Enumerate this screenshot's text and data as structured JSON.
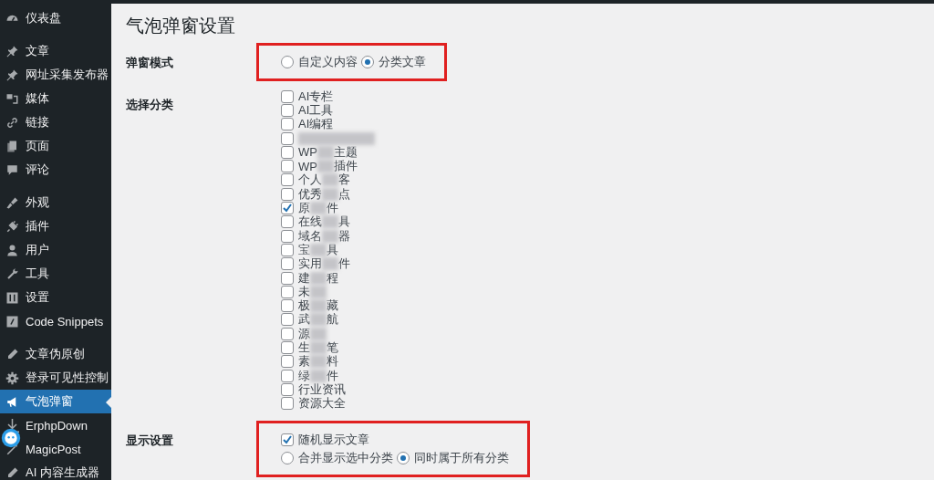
{
  "sidebar": {
    "groups": [
      [
        {
          "label": "仪表盘",
          "selected": false
        }
      ],
      [
        {
          "label": "文章",
          "selected": false
        },
        {
          "label": "网址采集发布器",
          "selected": false
        },
        {
          "label": "媒体",
          "selected": false
        },
        {
          "label": "链接",
          "selected": false
        },
        {
          "label": "页面",
          "selected": false
        },
        {
          "label": "评论",
          "selected": false
        }
      ],
      [
        {
          "label": "外观",
          "selected": false
        },
        {
          "label": "插件",
          "selected": false
        },
        {
          "label": "用户",
          "selected": false
        },
        {
          "label": "工具",
          "selected": false
        },
        {
          "label": "设置",
          "selected": false
        },
        {
          "label": "Code Snippets",
          "selected": false
        }
      ],
      [
        {
          "label": "文章伪原创",
          "selected": false
        },
        {
          "label": "登录可见性控制",
          "selected": false
        },
        {
          "label": "气泡弹窗",
          "selected": true
        },
        {
          "label": "ErphpDown",
          "selected": false
        },
        {
          "label": "MagicPost",
          "selected": false
        },
        {
          "label": "AI 内容生成器",
          "selected": false
        }
      ]
    ]
  },
  "page": {
    "title": "气泡弹窗设置",
    "rows": [
      {
        "kind": "radio",
        "label": "弹窗模式",
        "highlighted": true,
        "options": [
          {
            "label": "自定义内容",
            "selected": false
          },
          {
            "label": "分类文章",
            "selected": true
          }
        ]
      },
      {
        "kind": "checklist",
        "label": "选择分类",
        "highlighted": false,
        "items": [
          {
            "start": "AI专栏",
            "checked": false,
            "blurred": false
          },
          {
            "start": "AI工具",
            "checked": false,
            "blurred": false
          },
          {
            "start": "AI编程",
            "checked": false,
            "blurred": false
          },
          {
            "checked": false,
            "blurred": true
          },
          {
            "start": "WP",
            "end": "主题",
            "checked": false,
            "blurred": true
          },
          {
            "start": "WP",
            "end": "插件",
            "checked": false,
            "blurred": true
          },
          {
            "start": "个人",
            "end": "客",
            "checked": false,
            "blurred": true
          },
          {
            "start": "优秀",
            "end": "点",
            "checked": false,
            "blurred": true
          },
          {
            "start": "原",
            "end": "件",
            "checked": true,
            "blurred": true
          },
          {
            "start": "在线",
            "end": "具",
            "checked": false,
            "blurred": true
          },
          {
            "start": "域名",
            "end": "器",
            "checked": false,
            "blurred": true
          },
          {
            "start": "宝",
            "end": "具",
            "checked": false,
            "blurred": true
          },
          {
            "start": "实用",
            "end": "件",
            "checked": false,
            "blurred": true
          },
          {
            "start": "建",
            "end": "程",
            "checked": false,
            "blurred": true
          },
          {
            "start": "未",
            "checked": false,
            "blurred": true
          },
          {
            "start": "极",
            "end": "藏",
            "checked": false,
            "blurred": true
          },
          {
            "start": "武",
            "end": "航",
            "checked": false,
            "blurred": true
          },
          {
            "start": "源",
            "checked": false,
            "blurred": true
          },
          {
            "start": "生",
            "end": "笔",
            "checked": false,
            "blurred": true
          },
          {
            "start": "素",
            "end": "料",
            "checked": false,
            "blurred": true
          },
          {
            "start": "绿",
            "end": "件",
            "checked": false,
            "blurred": true
          },
          {
            "start": "行业资讯",
            "checked": false,
            "blurred": false
          },
          {
            "start": "资源大全",
            "checked": false,
            "blurred": false
          }
        ]
      },
      {
        "kind": "display",
        "label": "显示设置",
        "highlighted": true,
        "checkbox": {
          "label": "随机显示文章",
          "checked": true
        },
        "options": [
          {
            "label": "合并显示选中分类",
            "selected": false
          },
          {
            "label": "同时属于所有分类",
            "selected": true
          }
        ]
      }
    ]
  }
}
